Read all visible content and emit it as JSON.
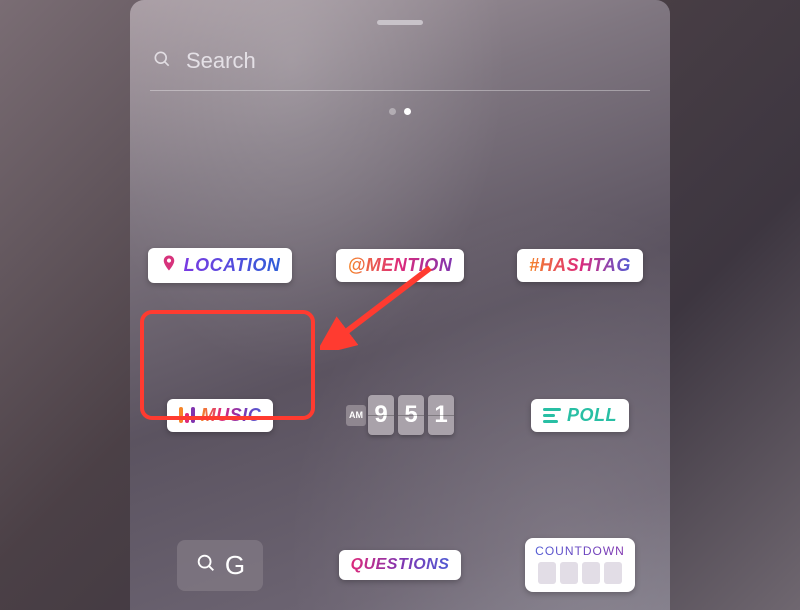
{
  "search": {
    "placeholder": "Search"
  },
  "pager": {
    "count": 2,
    "active_index": 1
  },
  "stickers": {
    "location": {
      "label": "LOCATION"
    },
    "mention": {
      "label": "@MENTION"
    },
    "hashtag": {
      "label": "#HASHTAG"
    },
    "music": {
      "label": "MUSIC"
    },
    "time": {
      "ampm": "AM",
      "digits": [
        "9",
        "5",
        "1"
      ]
    },
    "poll": {
      "label": "POLL"
    },
    "gif": {
      "label": "G"
    },
    "questions": {
      "label": "QUESTIONS"
    },
    "countdown": {
      "label": "COUNTDOWN"
    }
  },
  "annotation": {
    "highlighted_sticker": "music"
  }
}
